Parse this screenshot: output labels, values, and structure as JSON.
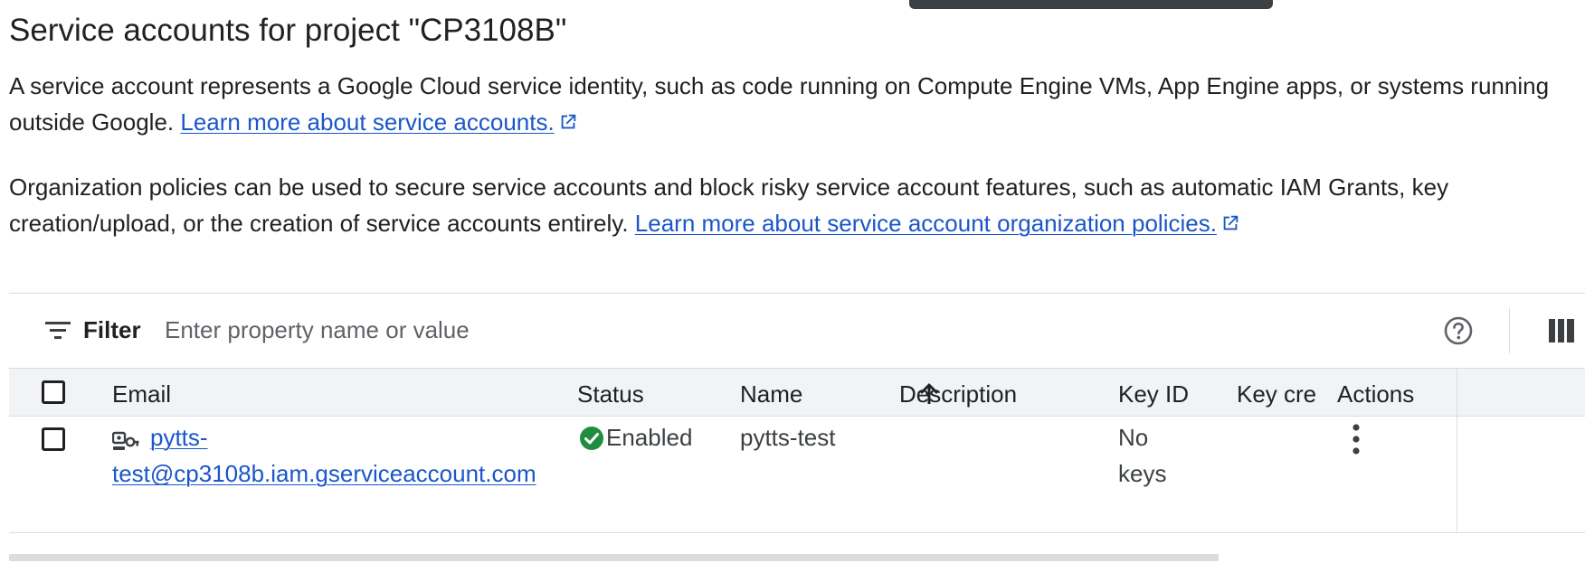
{
  "page": {
    "title": "Service accounts for project \"CP3108B\"",
    "intro_text": "A service account represents a Google Cloud service identity, such as code running on Compute Engine VMs, App Engine apps, or systems running outside Google. ",
    "intro_link": "Learn more about service accounts.",
    "policy_text": "Organization policies can be used to secure service accounts and block risky service account features, such as automatic IAM Grants, key creation/upload, or the creation of service accounts entirely. ",
    "policy_link": "Learn more about service account organization policies."
  },
  "filter": {
    "label": "Filter",
    "placeholder": "Enter property name or value"
  },
  "table": {
    "columns": {
      "email": "Email",
      "status": "Status",
      "name": "Name",
      "description": "Description",
      "key_id": "Key ID",
      "key_created": "Key creation date",
      "actions": "Actions"
    },
    "sort": {
      "column": "Name",
      "direction": "ascending",
      "icon": "arrow-up-icon"
    },
    "rows": [
      {
        "email": "pytts-test@cp3108b.iam.gserviceaccount.com",
        "status": "Enabled",
        "name": "pytts-test",
        "description": "",
        "key_id": "No keys",
        "key_created": ""
      }
    ]
  },
  "icons": {
    "filter": "filter-icon",
    "help": "help-icon",
    "columns": "column-display-icon",
    "service_account": "service-account-key-icon",
    "status": "check-circle-icon",
    "actions": "more-vert-icon",
    "external": "open-in-new-icon"
  },
  "colors": {
    "link": "#1a56c9",
    "status_ok": "#1e8e3e",
    "header_bg": "#f1f3f4",
    "text": "#202124"
  }
}
